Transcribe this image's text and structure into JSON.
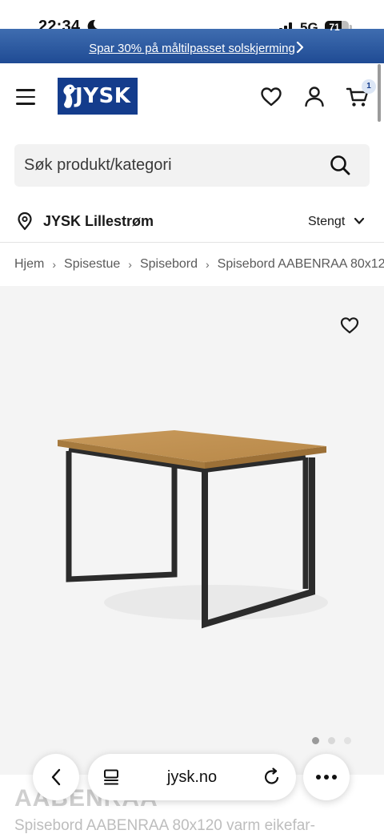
{
  "status": {
    "time": "22:34",
    "network": "5G",
    "battery": "71",
    "battery_level": 0.71
  },
  "promo": {
    "text": "Spar 30% på måltilpasset solskjerming"
  },
  "header": {
    "logo_text": "JYSK",
    "cart_count": "1"
  },
  "search": {
    "placeholder": "Søk produkt/kategori"
  },
  "store": {
    "name": "JYSK Lillestrøm",
    "status": "Stengt"
  },
  "breadcrumb": {
    "items": [
      "Hjem",
      "Spisestue",
      "Spisebord",
      "Spisebord AABENRAA 80x12"
    ],
    "separator": "›"
  },
  "product": {
    "name": "AABENRAA",
    "description": "Spisebord AABENRAA 80x120 varm eikefar-",
    "gallery_count": 3,
    "gallery_active": 1
  },
  "browser": {
    "url": "jysk.no"
  },
  "colors": {
    "brand_blue": "#143c8c",
    "promo_blue": "#2a5aa3",
    "image_bg": "#f4f4f4"
  }
}
